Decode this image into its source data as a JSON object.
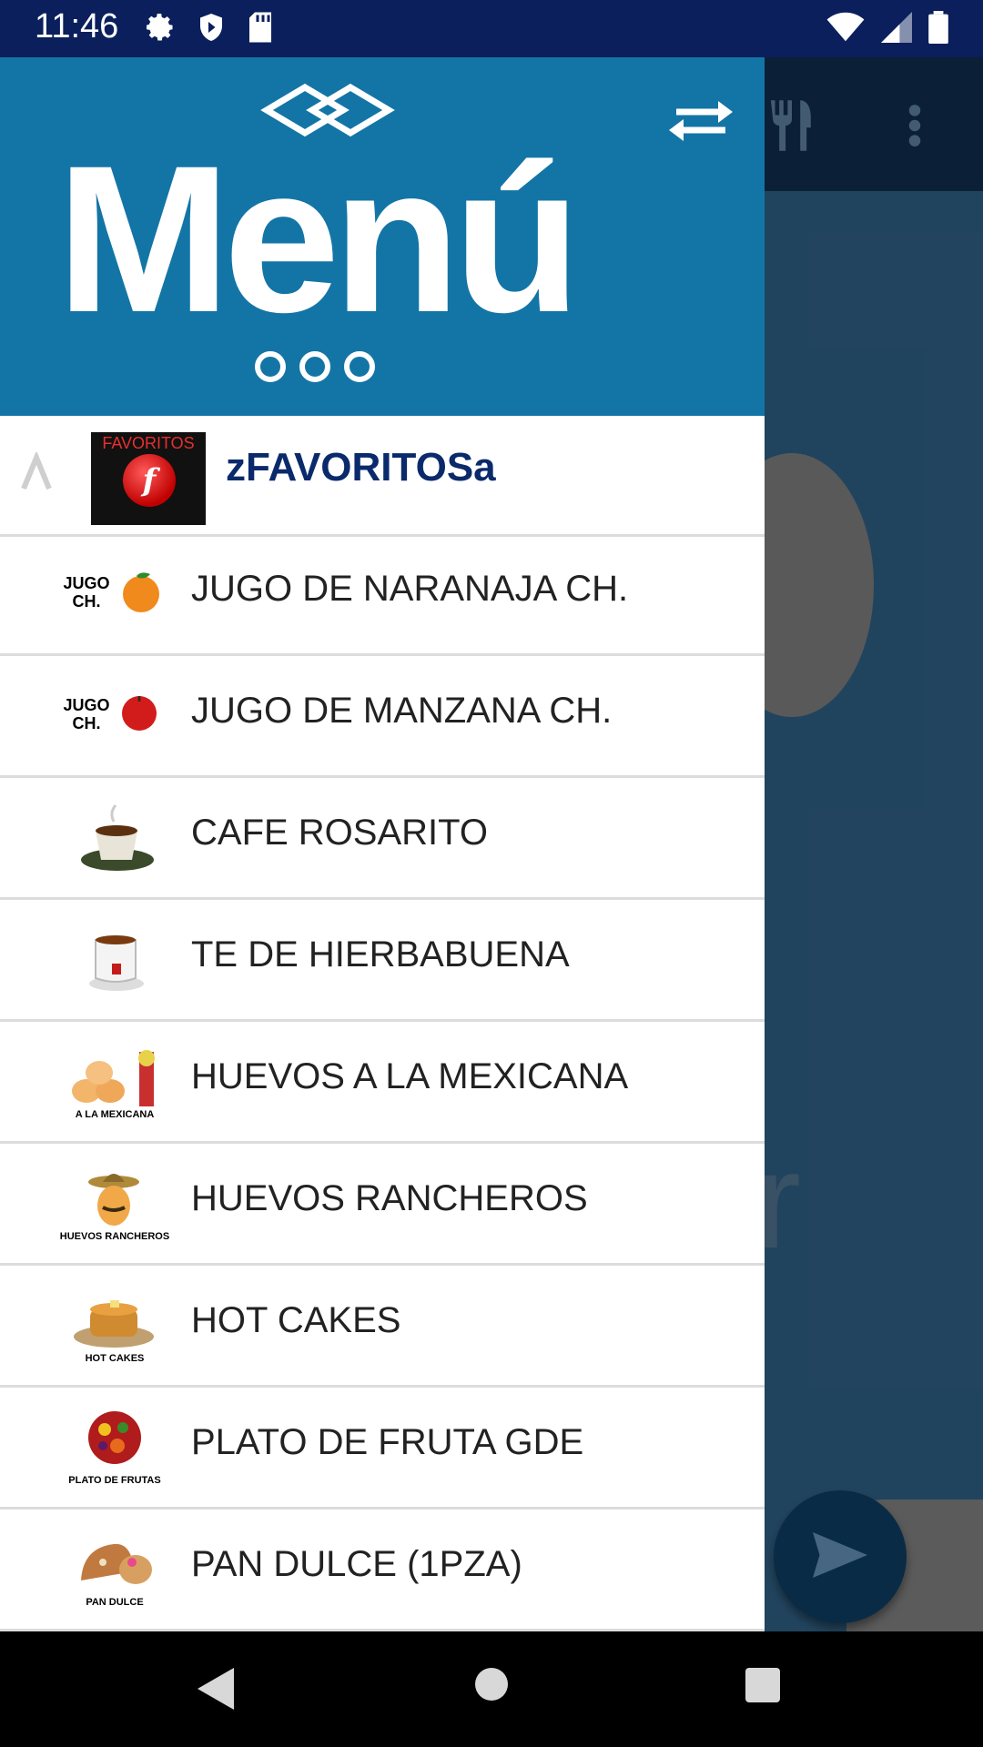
{
  "status_bar": {
    "time": "11:46"
  },
  "header": {
    "title": "Menú"
  },
  "favorites": {
    "label": "zFAVORITOSa",
    "image_caption": "FAVORITOS"
  },
  "items": [
    {
      "label": "JUGO DE NARANAJA CH.",
      "thumb": "orange-juice",
      "thumb_text": "JUGO CH."
    },
    {
      "label": "JUGO DE MANZANA CH.",
      "thumb": "apple-juice",
      "thumb_text": "JUGO CH."
    },
    {
      "label": "CAFE ROSARITO",
      "thumb": "coffee-cup",
      "thumb_text": ""
    },
    {
      "label": "TE DE HIERBABUENA",
      "thumb": "tea-cup",
      "thumb_text": ""
    },
    {
      "label": "HUEVOS A LA MEXICANA",
      "thumb": "eggs-mexican",
      "thumb_text": "A LA MEXICANA"
    },
    {
      "label": "HUEVOS RANCHEROS",
      "thumb": "eggs-ranchero",
      "thumb_text": "HUEVOS RANCHEROS"
    },
    {
      "label": "HOT CAKES",
      "thumb": "pancakes",
      "thumb_text": "HOT CAKES"
    },
    {
      "label": "PLATO DE FRUTA GDE",
      "thumb": "fruit-plate",
      "thumb_text": "PLATO DE FRUTAS"
    },
    {
      "label": "PAN DULCE (1PZA)",
      "thumb": "sweet-bread",
      "thumb_text": "PAN DULCE"
    }
  ],
  "colors": {
    "header_bg": "#1375a6",
    "status_bar_bg": "#0a1f5c",
    "favorites_text": "#0a2a6b"
  }
}
